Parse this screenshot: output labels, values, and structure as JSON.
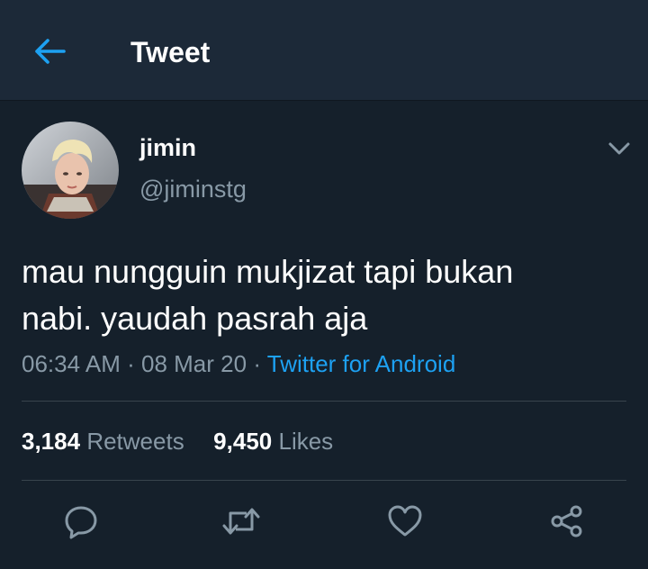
{
  "header": {
    "title": "Tweet",
    "back_icon": "arrow-left-icon"
  },
  "tweet": {
    "display_name": "jimin",
    "handle": "@jiminstg",
    "text_lines": [
      "mau nungguin mukjizat tapi bukan",
      "nabi. yaudah pasrah aja"
    ],
    "time": "06:34 AM",
    "separator": "·",
    "date": "08 Mar 20",
    "source": "Twitter for Android",
    "retweets": {
      "count": "3,184",
      "label": "Retweets"
    },
    "likes": {
      "count": "9,450",
      "label": "Likes"
    }
  },
  "icons": {
    "back": "arrow-left-icon",
    "menu": "chevron-down-icon",
    "reply": "reply-icon",
    "retweet": "retweet-icon",
    "like": "heart-icon",
    "share": "share-icon"
  },
  "colors": {
    "background": "#15202b",
    "header_background": "#1c2938",
    "accent": "#1da1f2",
    "secondary_text": "#8899a6"
  }
}
